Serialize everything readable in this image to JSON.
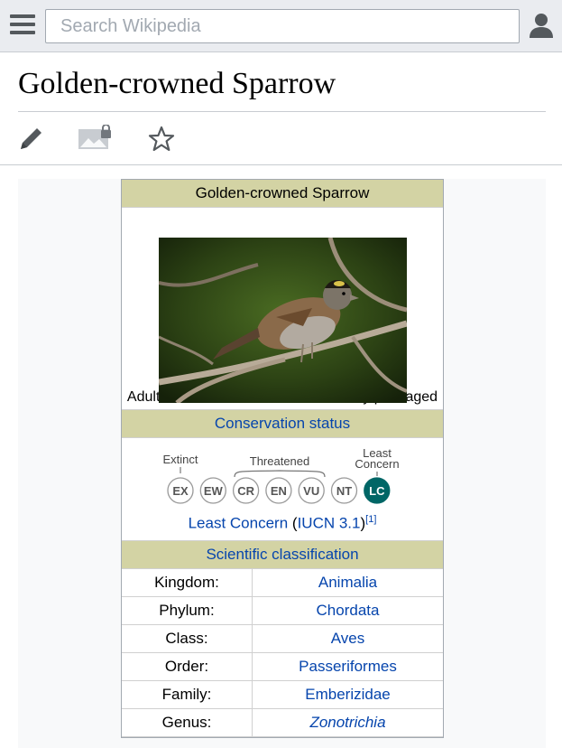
{
  "header": {
    "search_placeholder": "Search Wikipedia"
  },
  "article": {
    "title": "Golden-crowned Sparrow"
  },
  "infobox": {
    "title": "Golden-crowned Sparrow",
    "caption": "Adult; males and females are similarly plumaged",
    "conservation_heading": "Conservation status",
    "status_scale": {
      "group_labels": [
        "Extinct",
        "Threatened",
        "Least",
        "Concern"
      ],
      "codes": [
        "EX",
        "EW",
        "CR",
        "EN",
        "VU",
        "NT",
        "LC"
      ],
      "selected": "LC",
      "selected_color": "#006666"
    },
    "status_text": "Least Concern",
    "status_source": "IUCN 3.1",
    "status_ref": "[1]",
    "classification_heading": "Scientific classification",
    "taxonomy": [
      {
        "label": "Kingdom:",
        "value": "Animalia"
      },
      {
        "label": "Phylum:",
        "value": "Chordata"
      },
      {
        "label": "Class:",
        "value": "Aves"
      },
      {
        "label": "Order:",
        "value": "Passeriformes"
      },
      {
        "label": "Family:",
        "value": "Emberizidae"
      },
      {
        "label": "Genus:",
        "value": "Zonotrichia"
      }
    ]
  },
  "icons": {
    "menu": "hamburger-menu-icon",
    "user": "user-icon",
    "edit": "pencil-icon",
    "image": "image-locked-icon",
    "watch": "star-icon"
  },
  "colors": {
    "link": "#0645ad",
    "infobox_header": "#d3d3a4"
  }
}
